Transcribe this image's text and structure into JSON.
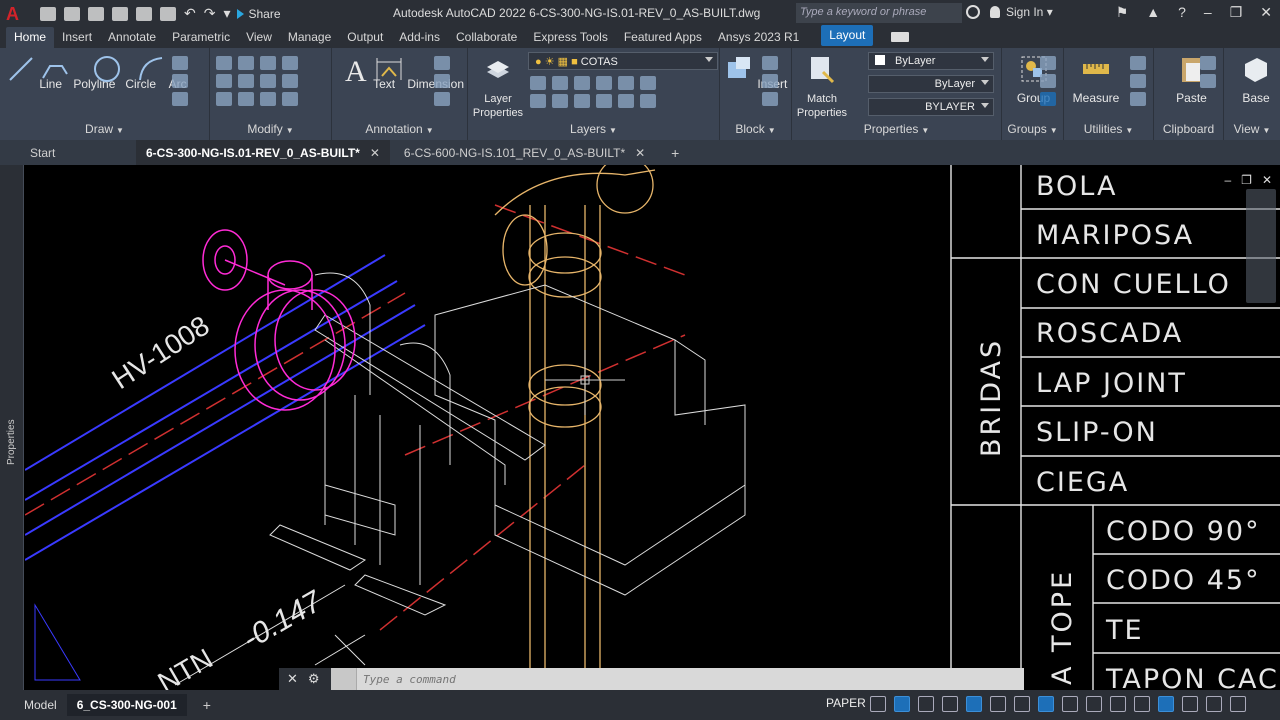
{
  "app": {
    "logo": "A",
    "title": "Autodesk AutoCAD 2022   6-CS-300-NG-IS.01-REV_0_AS-BUILT.dwg",
    "share": "Share",
    "search_placeholder": "Type a keyword or phrase",
    "sign_in": "Sign In"
  },
  "ribbon_tabs": [
    "Home",
    "Insert",
    "Annotate",
    "Parametric",
    "View",
    "Manage",
    "Output",
    "Add-ins",
    "Collaborate",
    "Express Tools",
    "Featured Apps",
    "Ansys 2023 R1",
    "Layout"
  ],
  "panels": {
    "draw": {
      "title": "Draw",
      "line": "Line",
      "polyline": "Polyline",
      "circle": "Circle",
      "arc": "Arc"
    },
    "modify": {
      "title": "Modify"
    },
    "annotation": {
      "title": "Annotation",
      "text": "Text",
      "dimension": "Dimension"
    },
    "layers": {
      "title": "Layers",
      "layer_properties": "Layer Properties",
      "current_layer": "COTAS"
    },
    "block": {
      "title": "Block",
      "insert": "Insert"
    },
    "properties": {
      "title": "Properties",
      "match": "Match Properties",
      "color": "ByLayer",
      "linetype": "ByLayer",
      "lineweight": "BYLAYER"
    },
    "groups": {
      "title": "Groups",
      "group": "Group"
    },
    "utilities": {
      "title": "Utilities",
      "measure": "Measure"
    },
    "clipboard": {
      "title": "Clipboard",
      "paste": "Paste"
    },
    "view": {
      "title": "View",
      "base": "Base"
    }
  },
  "doc_tabs": {
    "start": "Start",
    "tab1": "6-CS-300-NG-IS.01-REV_0_AS-BUILT*",
    "tab2": "6-CS-600-NG-IS.101_REV_0_AS-BUILT*"
  },
  "side_palette": "Properties",
  "drawing": {
    "valve_tag": "HV-1008",
    "elevation": "-0.147",
    "ntn": "NTN",
    "table": {
      "group_bridas": "BRIDAS",
      "group_tope": "A TOPE",
      "rows_top": [
        "BOLA",
        "MARIPOSA",
        "CON CUELLO",
        "ROSCADA",
        "LAP JOINT",
        "SLIP-ON",
        "CIEGA"
      ],
      "rows_bottom": [
        "CODO 90°",
        "CODO 45°",
        "TE",
        "TAPON CAC"
      ]
    }
  },
  "command_line": {
    "placeholder": "Type a command"
  },
  "status": {
    "model": "Model",
    "layout": "6_CS-300-NG-001",
    "paper": "PAPER"
  }
}
